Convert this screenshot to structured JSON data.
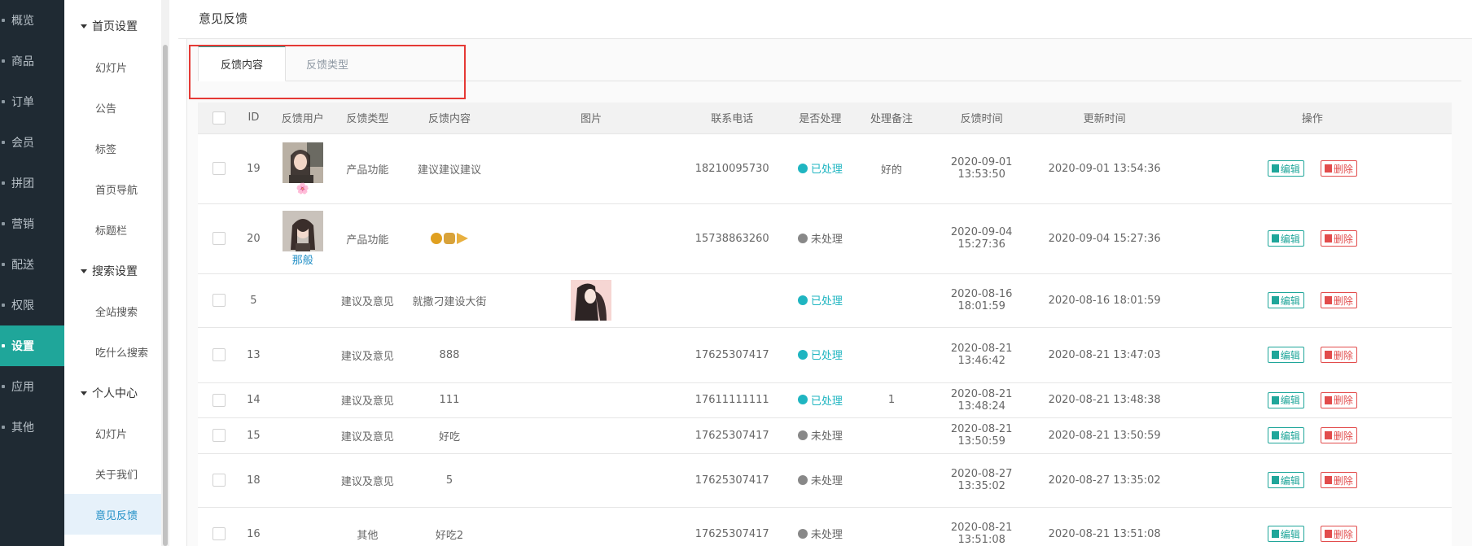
{
  "nav": {
    "items": [
      {
        "label": "概览"
      },
      {
        "label": "商品"
      },
      {
        "label": "订单"
      },
      {
        "label": "会员"
      },
      {
        "label": "拼团"
      },
      {
        "label": "营销"
      },
      {
        "label": "配送"
      },
      {
        "label": "权限"
      },
      {
        "label": "设置"
      },
      {
        "label": "应用"
      },
      {
        "label": "其他"
      }
    ],
    "active": "设置"
  },
  "submenu": {
    "group_home": "首页设置",
    "home_items": [
      "幻灯片",
      "公告",
      "标签",
      "首页导航",
      "标题栏"
    ],
    "group_search": "搜索设置",
    "search_items": [
      "全站搜索",
      "吃什么搜索"
    ],
    "group_personal": "个人中心",
    "personal_items": [
      "幻灯片",
      "关于我们",
      "意见反馈"
    ]
  },
  "page": {
    "title": "意见反馈",
    "tabs": [
      "反馈内容",
      "反馈类型"
    ]
  },
  "table": {
    "headers": [
      "ID",
      "反馈用户",
      "反馈类型",
      "反馈内容",
      "图片",
      "联系电话",
      "是否处理",
      "处理备注",
      "反馈时间",
      "更新时间",
      "操作"
    ],
    "rows": [
      {
        "id": "19",
        "user": "🌸",
        "type": "产品功能",
        "content": "建议建议建议",
        "phone": "18210095730",
        "status": "已处理",
        "note": "好的",
        "created": "2020-09-01 13:53:50",
        "updated": "2020-09-01 13:54:36"
      },
      {
        "id": "20",
        "user": "那般",
        "type": "产品功能",
        "content": "",
        "phone": "15738863260",
        "status": "未处理",
        "note": "",
        "created": "2020-09-04 15:27:36",
        "updated": "2020-09-04 15:27:36"
      },
      {
        "id": "5",
        "user": "",
        "type": "建议及意见",
        "content": "就撒刁建设大街",
        "phone": "",
        "status": "已处理",
        "note": "",
        "created": "2020-08-16 18:01:59",
        "updated": "2020-08-16 18:01:59"
      },
      {
        "id": "13",
        "user": "",
        "type": "建议及意见",
        "content": "888",
        "phone": "17625307417",
        "status": "已处理",
        "note": "",
        "created": "2020-08-21 13:46:42",
        "updated": "2020-08-21 13:47:03"
      },
      {
        "id": "14",
        "user": "",
        "type": "建议及意见",
        "content": "111",
        "phone": "17611111111",
        "status": "已处理",
        "note": "1",
        "created": "2020-08-21 13:48:24",
        "updated": "2020-08-21 13:48:38"
      },
      {
        "id": "15",
        "user": "",
        "type": "建议及意见",
        "content": "好吃",
        "phone": "17625307417",
        "status": "未处理",
        "note": "",
        "created": "2020-08-21 13:50:59",
        "updated": "2020-08-21 13:50:59"
      },
      {
        "id": "18",
        "user": "",
        "type": "建议及意见",
        "content": "5",
        "phone": "17625307417",
        "status": "未处理",
        "note": "",
        "created": "2020-08-27 13:35:02",
        "updated": "2020-08-27 13:35:02"
      },
      {
        "id": "16",
        "user": "",
        "type": "其他",
        "content": "好吃2",
        "phone": "17625307417",
        "status": "未处理",
        "note": "",
        "created": "2020-08-21 13:51:08",
        "updated": "2020-08-21 13:51:08"
      }
    ],
    "actions": {
      "edit": "编辑",
      "delete": "删除"
    }
  },
  "colors": {
    "accent": "#1fa69a",
    "done": "#1fb5c1",
    "pending": "#888888",
    "danger": "#e24c4c",
    "highlight": "#e53935"
  },
  "icons": {
    "edit": "edit-icon",
    "delete": "trash-icon",
    "checkbox": "checkbox-icon"
  }
}
